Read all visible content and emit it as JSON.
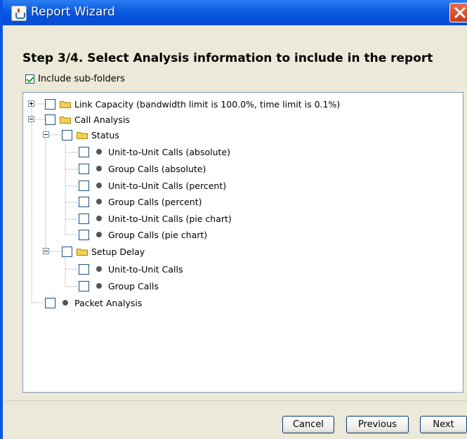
{
  "window": {
    "title": "Report Wizard"
  },
  "heading": "Step 3/4. Select Analysis information to include in the report",
  "include_subfolders": {
    "label": "Include sub-folders",
    "checked": true
  },
  "tree": {
    "nodes": [
      {
        "label": "Link Capacity (bandwidth limit is 100.0%, time limit is 0.1%)",
        "type": "folder",
        "expanded": false,
        "checked": false
      },
      {
        "label": "Call Analysis",
        "type": "folder",
        "expanded": true,
        "checked": false
      },
      {
        "label": "Status",
        "type": "folder",
        "expanded": true,
        "checked": false
      },
      {
        "label": "Unit-to-Unit Calls (absolute)",
        "type": "leaf",
        "checked": false
      },
      {
        "label": "Group Calls (absolute)",
        "type": "leaf",
        "checked": false
      },
      {
        "label": "Unit-to-Unit Calls (percent)",
        "type": "leaf",
        "checked": false
      },
      {
        "label": "Group Calls (percent)",
        "type": "leaf",
        "checked": false
      },
      {
        "label": "Unit-to-Unit Calls (pie chart)",
        "type": "leaf",
        "checked": false
      },
      {
        "label": "Group Calls (pie chart)",
        "type": "leaf",
        "checked": false
      },
      {
        "label": "Setup Delay",
        "type": "folder",
        "expanded": true,
        "checked": false
      },
      {
        "label": "Unit-to-Unit Calls",
        "type": "leaf",
        "checked": false
      },
      {
        "label": "Group Calls",
        "type": "leaf",
        "checked": false
      },
      {
        "label": "Packet Analysis",
        "type": "leaf",
        "checked": false
      }
    ]
  },
  "buttons": {
    "cancel": "Cancel",
    "previous": "Previous",
    "next": "Next"
  },
  "colors": {
    "titlebar": "#0550dc",
    "folder": "#f4cf55",
    "close": "#d9461f"
  }
}
